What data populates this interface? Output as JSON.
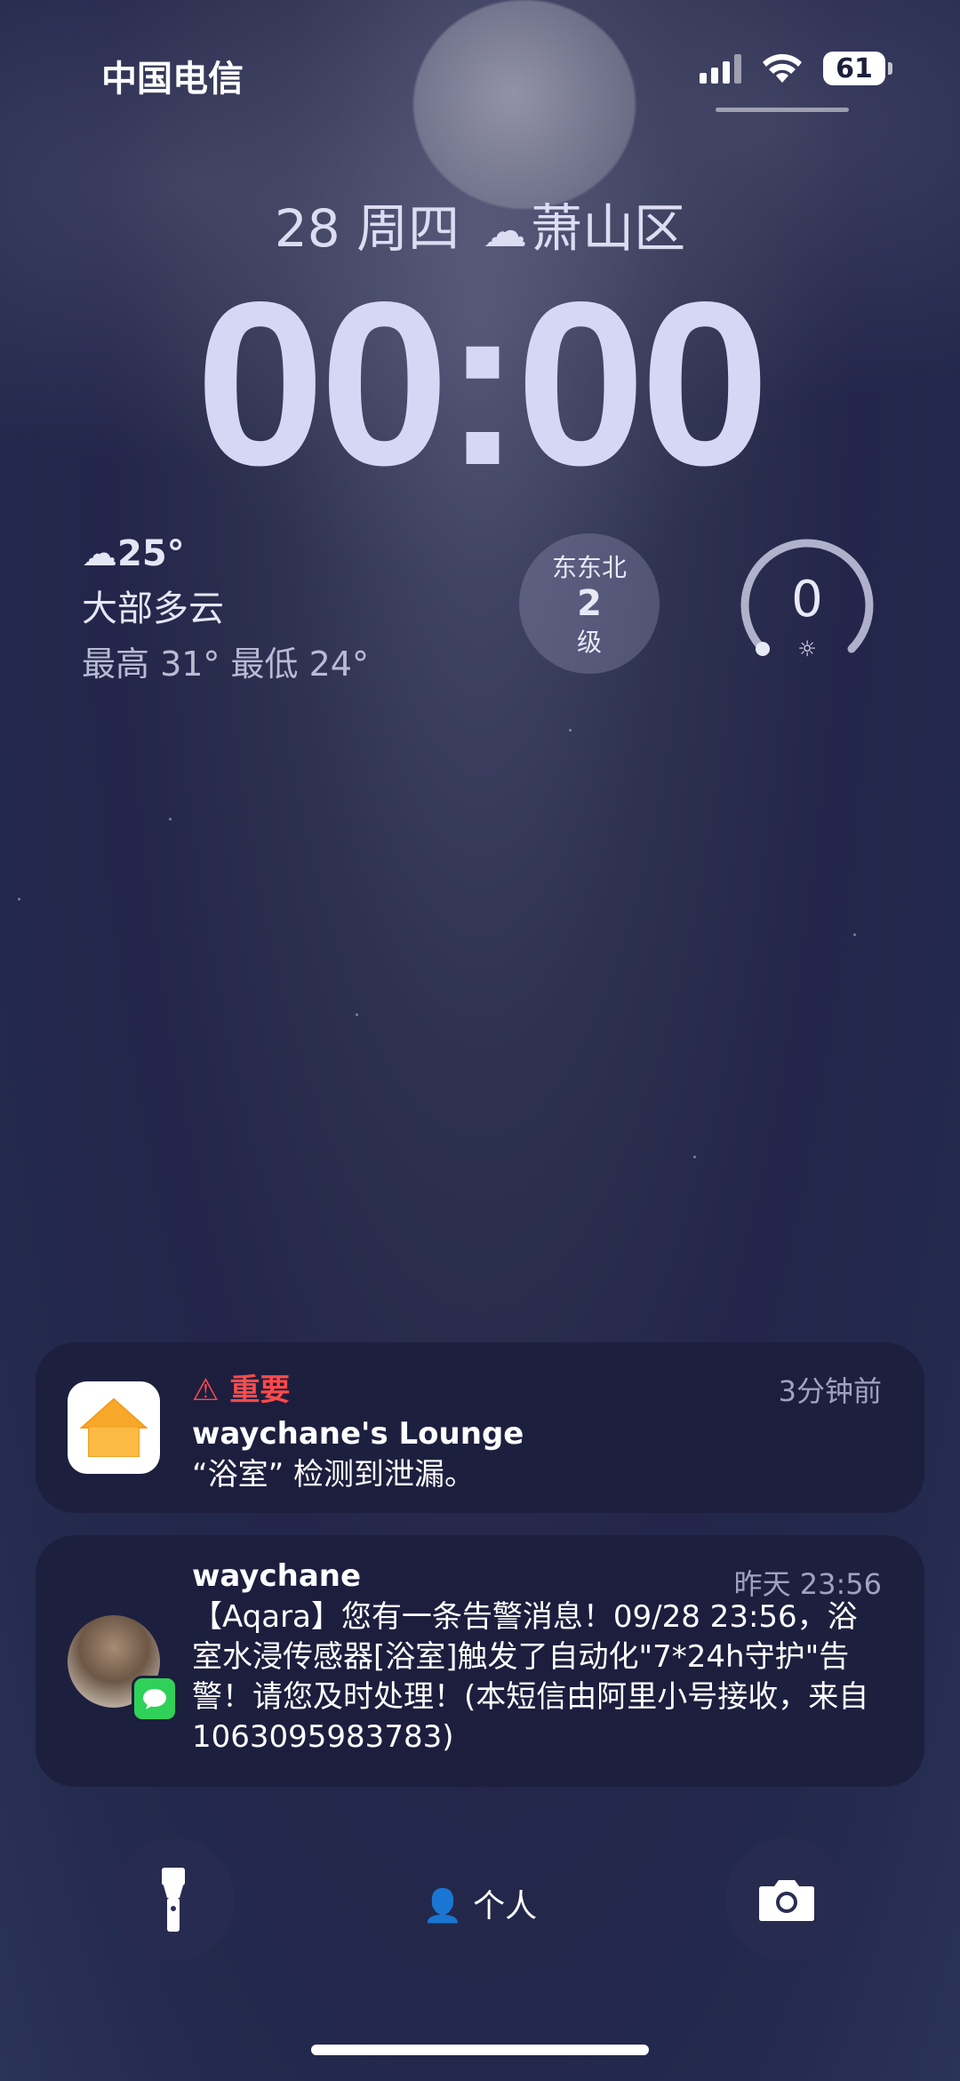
{
  "status_bar": {
    "carrier": "中国电信",
    "battery": "61"
  },
  "lock": {
    "date": "28 周四",
    "location": "萧山区",
    "time": "00:00"
  },
  "weather": {
    "temp": "25°",
    "condition": "大部多云",
    "range": "最高 31° 最低 24°"
  },
  "wind": {
    "direction": "东东北",
    "level": "2",
    "unit": "级"
  },
  "uv": {
    "value": "0"
  },
  "notifications": [
    {
      "important_label": "重要",
      "app": "waychane's Lounge",
      "text": "“浴室” 检测到泄漏。",
      "time": "3分钟前"
    },
    {
      "sender": "waychane",
      "time": "昨天 23:56",
      "text": "【Aqara】您有一条告警消息！09/28 23:56，浴室水浸传感器[浴室]触发了自动化\"7*24h守护\"告警！请您及时处理！(本短信由阿里小号接收，来自1063095983783)"
    }
  ],
  "bottom": {
    "focus_label": "个人"
  },
  "icons": {
    "home_app": "home-icon",
    "messages": "messages-icon",
    "flashlight": "flashlight-icon",
    "camera": "camera-icon",
    "wifi": "wifi-icon",
    "signal": "signal-icon",
    "cloud": "cloud-icon",
    "warning": "warning-icon",
    "person": "person-icon",
    "sun": "sun-icon"
  },
  "colors": {
    "important": "#ff4a4a",
    "messages_green": "#2fd158",
    "home_orange": "#f7a82b"
  }
}
